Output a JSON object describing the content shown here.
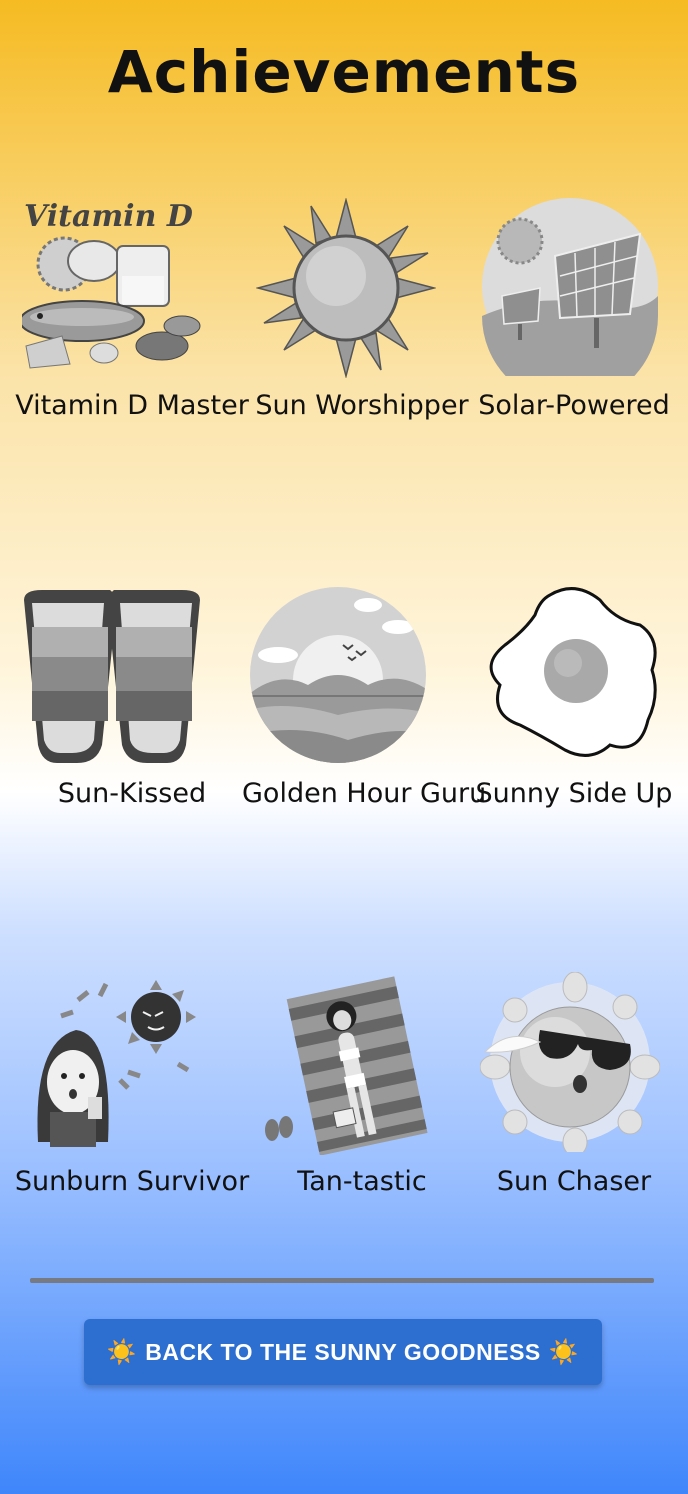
{
  "page": {
    "title": "Achievements"
  },
  "achievements": [
    {
      "label": "Vitamin D Master",
      "icon": "vitamin-d-icon",
      "art_text": "Vitamin D"
    },
    {
      "label": "Sun Worshipper",
      "icon": "sun-icon"
    },
    {
      "label": "Solar-Powered",
      "icon": "solar-panel-icon"
    },
    {
      "label": "Sun-Kissed",
      "icon": "sunglasses-icon"
    },
    {
      "label": "Golden Hour Guru",
      "icon": "sunset-icon"
    },
    {
      "label": "Sunny Side Up",
      "icon": "fried-egg-icon"
    },
    {
      "label": "Sunburn Survivor",
      "icon": "sunburn-icon"
    },
    {
      "label": "Tan-tastic",
      "icon": "sunbathing-icon"
    },
    {
      "label": "Sun Chaser",
      "icon": "cool-sun-icon"
    }
  ],
  "back_button": {
    "label": "BACK TO THE SUNNY GOODNESS",
    "left_emoji": "☀️",
    "right_emoji": "☀️"
  },
  "colors": {
    "button": "#2d6fd0",
    "gradient_top": "#f6bb22",
    "gradient_bottom": "#3f86fb",
    "divider": "#777a82"
  }
}
